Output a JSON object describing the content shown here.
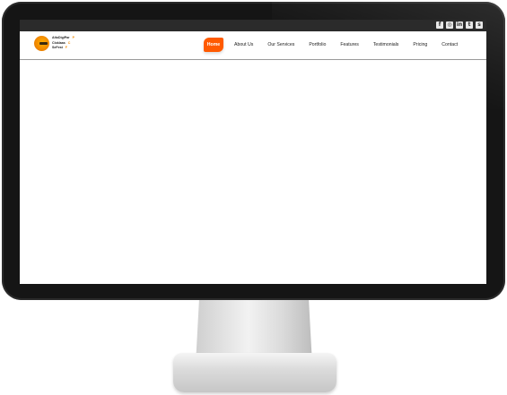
{
  "logo": {
    "lines": [
      "AltoDigiPar",
      "Cloklaas",
      "SeFest"
    ],
    "dots": [
      "P",
      "C",
      "F"
    ]
  },
  "social": [
    {
      "icon": "facebook-icon",
      "glyph": "f"
    },
    {
      "icon": "instagram-icon",
      "glyph": "◎"
    },
    {
      "icon": "linkedin-icon",
      "glyph": "in"
    },
    {
      "icon": "twitter-icon",
      "glyph": "t"
    },
    {
      "icon": "skype-icon",
      "glyph": "s"
    }
  ],
  "nav": {
    "items": [
      "Home",
      "About Us",
      "Our Services",
      "Portfolio",
      "Features",
      "Testimonials",
      "Pricing",
      "Contact"
    ],
    "active": "Home",
    "accent": "#ff5a00"
  }
}
